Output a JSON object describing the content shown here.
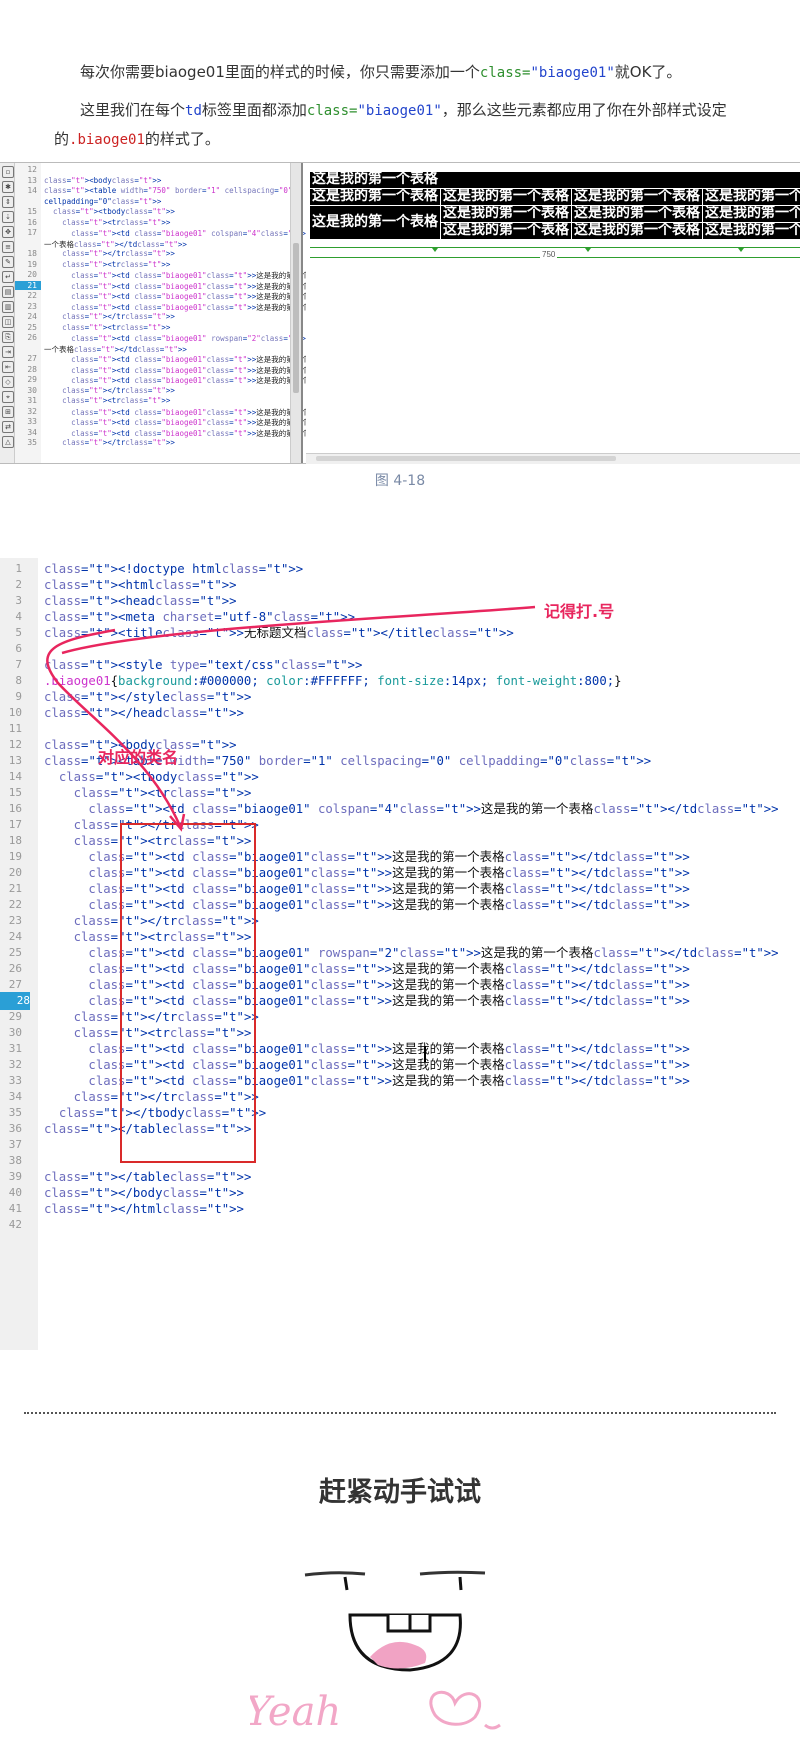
{
  "intro": {
    "p1": {
      "a": "每次你需要biaoge01里面的样式的时候，你只需要添加一个",
      "code_attr": "class=",
      "code_val": "\"biaoge01\"",
      "b": "就OK了。"
    },
    "p2": {
      "a": "这里我们在每个",
      "code_td": "td",
      "b": "标签里面都添加",
      "code_attr": "class=",
      "code_val": "\"biaoge01\"",
      "c": "，那么这些元素都应用了你在外部样",
      "d": "式设定的",
      "code_sel": ".biaoge01",
      "e": "的样式了。"
    }
  },
  "shot1": {
    "line_numbers": [
      "12",
      "13",
      "14",
      "",
      "15",
      "16",
      "17",
      "",
      "18",
      "19",
      "20",
      "21",
      "22",
      "23",
      "24",
      "25",
      "26",
      "",
      "27",
      "28",
      "29",
      "30",
      "31",
      "32",
      "33",
      "34",
      "35"
    ],
    "current_line": "21",
    "code_lines": [
      "",
      "<body>",
      "<table width=\"750\" border=\"1\" cellspacing=\"0\"",
      "cellpadding=\"0\">",
      "  <tbody>",
      "    <tr>",
      "      <td class=\"biaoge01\" colspan=\"4\">这是我的第",
      "一个表格</td>",
      "    </tr>",
      "    <tr>",
      "      <td class=\"biaoge01\">这是我的第一个表格</td>",
      "      <td class=\"biaoge01\">这是我的第一个表格</td>",
      "      <td class=\"biaoge01\">这是我的第一个表格</td>",
      "      <td class=\"biaoge01\">这是我的第一个表格</td>",
      "    </tr>",
      "    <tr>",
      "      <td class=\"biaoge01\" rowspan=\"2\">这是我的第",
      "一个表格</td>",
      "      <td class=\"biaoge01\">这是我的第一个表格</td>",
      "      <td class=\"biaoge01\">这是我的第一个表格</td>",
      "      <td class=\"biaoge01\">这是我的第一个表格</td>",
      "    </tr>",
      "    <tr>",
      "      <td class=\"biaoge01\">这是我的第一个表格</td>",
      "      <td class=\"biaoge01\">这是我的第一个表格</td>",
      "      <td class=\"biaoge01\">这是我的第一个表格</td>",
      "    </tr>"
    ],
    "cell_text": "这是我的第一个表格",
    "ruler_label": "750"
  },
  "caption": "图 4-18",
  "shot2": {
    "current_line": "28",
    "lines": [
      "<!doctype html>",
      "<html>",
      "<head>",
      "<meta charset=\"utf-8\">",
      "<title>无标题文档</title>",
      "",
      "<style type=\"text/css\">",
      ".biaoge01{background:#000000; color:#FFFFFF; font-size:14px; font-weight:800;}",
      "</style>",
      "</head>",
      "",
      "<body>",
      "<table width=\"750\" border=\"1\" cellspacing=\"0\" cellpadding=\"0\">",
      "  <tbody>",
      "    <tr>",
      "      <td class=\"biaoge01\" colspan=\"4\">这是我的第一个表格</td>",
      "    </tr>",
      "    <tr>",
      "      <td class=\"biaoge01\">这是我的第一个表格</td>",
      "      <td class=\"biaoge01\">这是我的第一个表格</td>",
      "      <td class=\"biaoge01\">这是我的第一个表格</td>",
      "      <td class=\"biaoge01\">这是我的第一个表格</td>",
      "    </tr>",
      "    <tr>",
      "      <td class=\"biaoge01\" rowspan=\"2\">这是我的第一个表格</td>",
      "      <td class=\"biaoge01\">这是我的第一个表格</td>",
      "      <td class=\"biaoge01\">这是我的第一个表格</td>",
      "      <td class=\"biaoge01\">这是我的第一个表格</td>",
      "    </tr>",
      "    <tr>",
      "      <td class=\"biaoge01\">这是我的第一个表格</td>",
      "      <td class=\"biaoge01\">这是我的第一个表格</td>",
      "      <td class=\"biaoge01\">这是我的第一个表格</td>",
      "    </tr>",
      "  </tbody>",
      "</table>",
      "",
      "",
      "</table>",
      "</body>",
      "</html>",
      ""
    ],
    "annotation_dot": "记得打.号",
    "annotation_class": "对应的类名"
  },
  "try_title": "赶紧动手试试",
  "doodle_text": "Yeah",
  "colors": {
    "annotation": "#e8265e",
    "box": "#d92a2a",
    "accent_line": "#2a9fd6"
  }
}
